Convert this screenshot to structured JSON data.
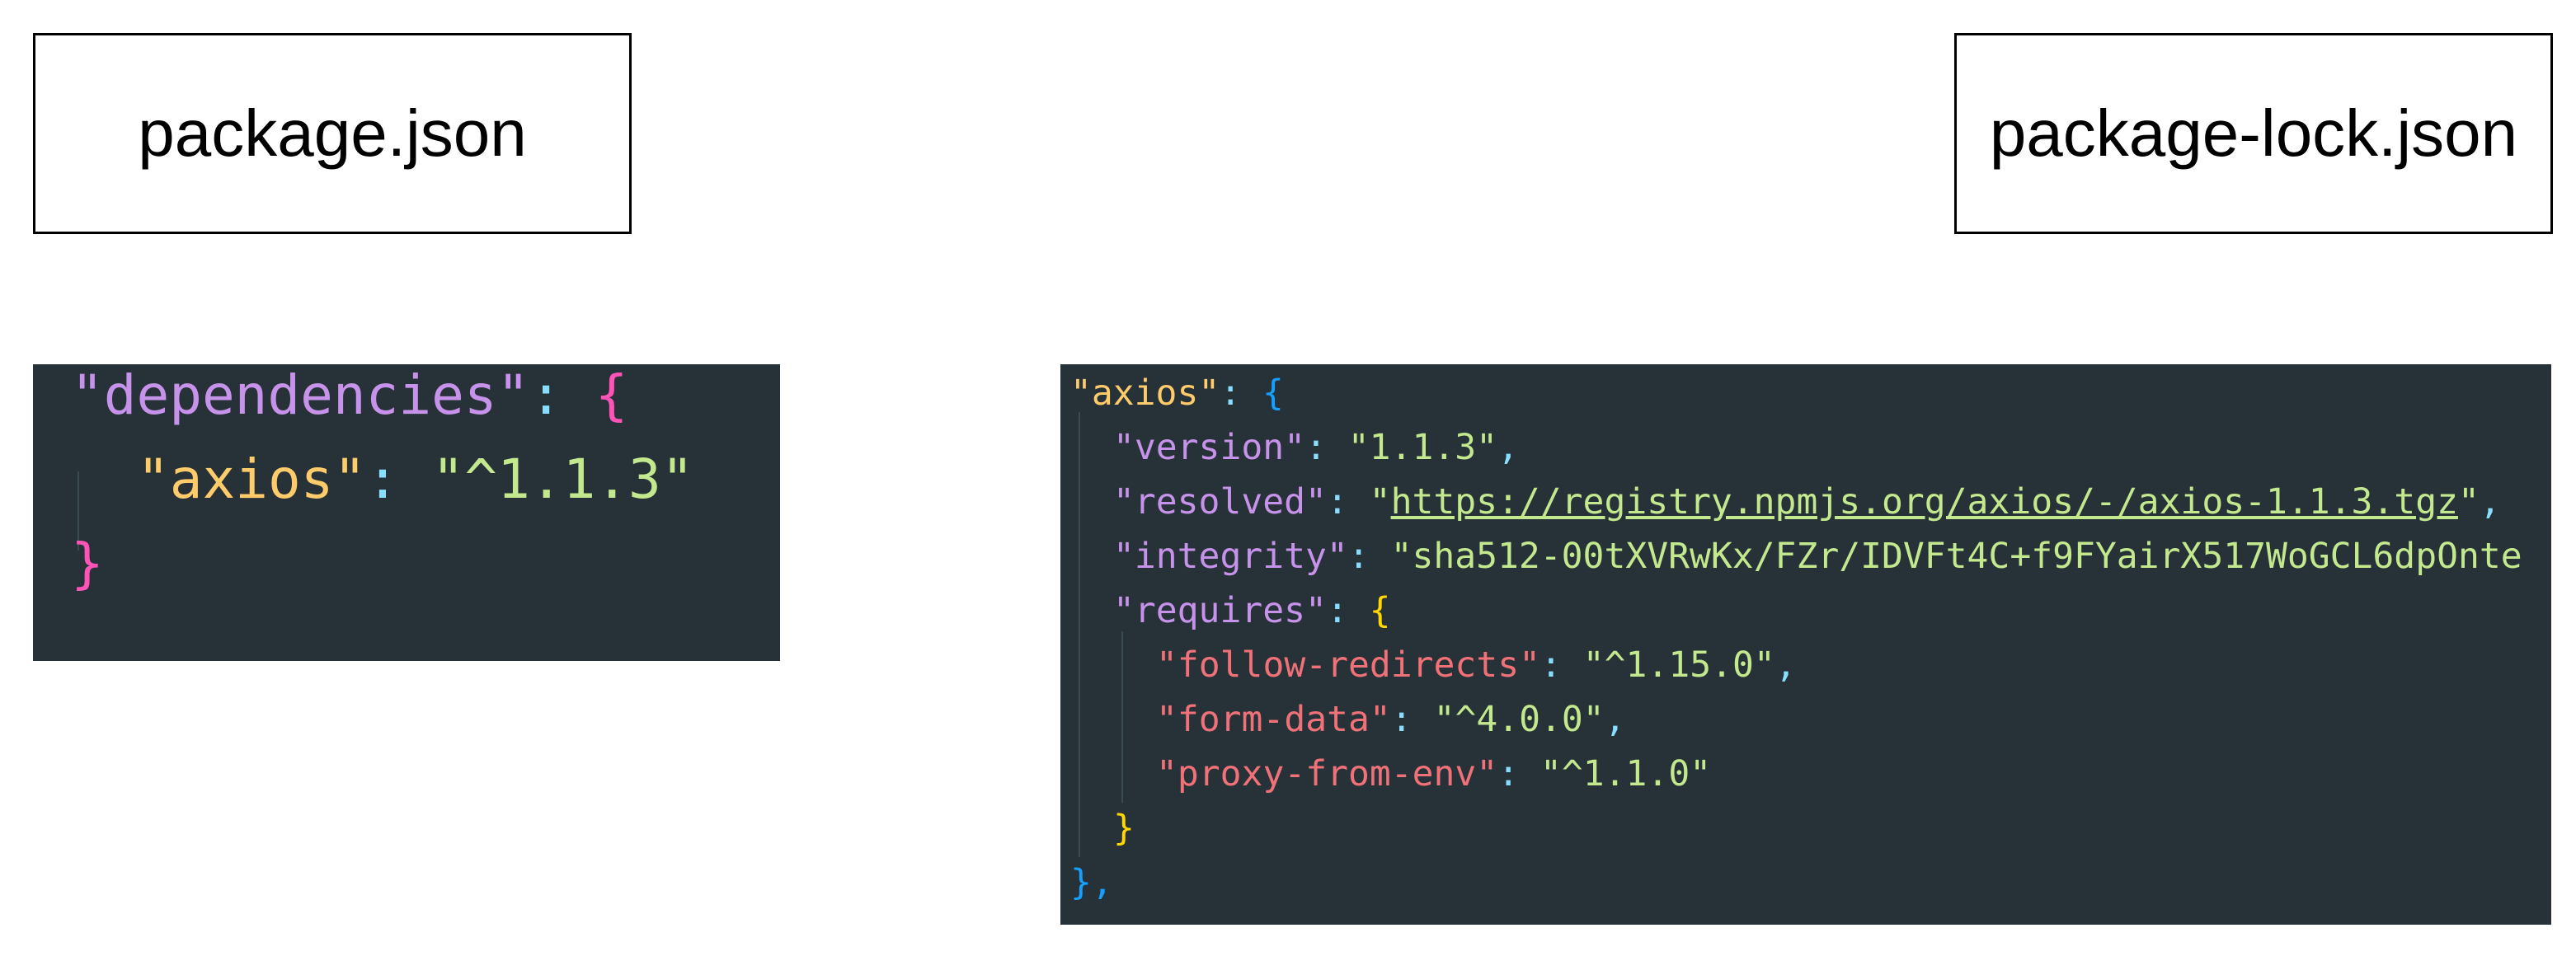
{
  "labels": {
    "package_json": "package.json",
    "package_lock_json": "package-lock.json"
  },
  "package_json_code": {
    "dependencies_key": "\"dependencies\"",
    "colon_open": ": ",
    "open_brace": "{",
    "axios_key": "\"axios\"",
    "colon": ": ",
    "axios_value": "\"^1.1.3\"",
    "close_brace": "}"
  },
  "package_lock_code": {
    "axios_key": "\"axios\"",
    "version_key": "\"version\"",
    "version_value": "\"1.1.3\"",
    "resolved_key": "\"resolved\"",
    "resolved_quote_open": "\"",
    "resolved_url": "https://registry.npmjs.org/axios/-/axios-1.1.3.tgz",
    "resolved_quote_close": "\"",
    "integrity_key": "\"integrity\"",
    "integrity_value": "\"sha512-00tXVRwKx/FZr/IDVFt4C+f9FYairX517WoGCL6dpOnte",
    "requires_key": "\"requires\"",
    "follow_redirects_key": "\"follow-redirects\"",
    "follow_redirects_value": "\"^1.15.0\"",
    "form_data_key": "\"form-data\"",
    "form_data_value": "\"^4.0.0\"",
    "proxy_from_env_key": "\"proxy-from-env\"",
    "proxy_from_env_value": "\"^1.1.0\"",
    "open_brace": "{",
    "close_brace": "}",
    "close_brace_comma": "},",
    "colon": ": ",
    "comma": ","
  },
  "colors": {
    "panel_bg": "#263238",
    "string": "#c3e88d",
    "key_purple": "#c792ea",
    "key_yellow": "#ffcb6b",
    "key_red": "#f07178",
    "punctuation": "#89ddff"
  }
}
